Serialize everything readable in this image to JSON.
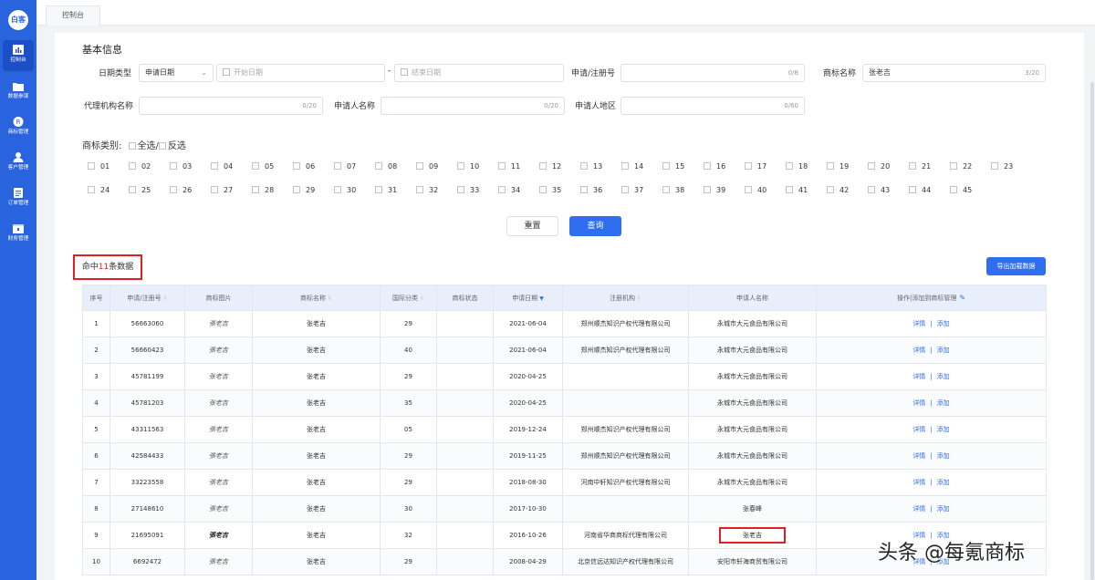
{
  "app": {
    "logo_text": "白客"
  },
  "sidebar": {
    "items": [
      {
        "label": "控制台",
        "icon": "chart-icon",
        "active": true
      },
      {
        "label": "数据参谋",
        "icon": "folder-icon",
        "active": false
      },
      {
        "label": "商标管理",
        "icon": "trademark-icon",
        "active": false
      },
      {
        "label": "客户管理",
        "icon": "user-icon",
        "active": false
      },
      {
        "label": "订单管理",
        "icon": "order-icon",
        "active": false
      },
      {
        "label": "财务管理",
        "icon": "finance-icon",
        "active": false
      }
    ]
  },
  "tabs": [
    {
      "label": "控制台"
    }
  ],
  "filters": {
    "section_title": "基本信息",
    "date_type_label": "日期类型",
    "date_type_value": "申请日期",
    "start_date_placeholder": "开始日期",
    "date_sep": "-",
    "end_date_placeholder": "结束日期",
    "reg_no_label": "申请/注册号",
    "reg_no_count": "0/8",
    "tm_name_label": "商标名称",
    "tm_name_value": "张老吉",
    "tm_name_count": "3/20",
    "agency_label": "代理机构名称",
    "agency_count": "0/20",
    "applicant_label": "申请人名称",
    "applicant_count": "0/20",
    "region_label": "申请人地区",
    "region_count": "0/60"
  },
  "categories": {
    "title": "商标类别:",
    "select_all": "全选/",
    "invert": "反选",
    "items": [
      "01",
      "02",
      "03",
      "04",
      "05",
      "06",
      "07",
      "08",
      "09",
      "10",
      "11",
      "12",
      "13",
      "14",
      "15",
      "16",
      "17",
      "18",
      "19",
      "20",
      "21",
      "22",
      "23",
      "24",
      "25",
      "26",
      "27",
      "28",
      "29",
      "30",
      "31",
      "32",
      "33",
      "34",
      "35",
      "36",
      "37",
      "38",
      "39",
      "40",
      "41",
      "42",
      "43",
      "44",
      "45"
    ]
  },
  "buttons": {
    "reset": "重置",
    "query": "查询",
    "export": "导出加载数据"
  },
  "results": {
    "prefix": "命中",
    "count": "11",
    "suffix": "条数据"
  },
  "table": {
    "headers": [
      "序号",
      "申请/注册号",
      "商标图片",
      "商标名称",
      "国际分类",
      "商标状态",
      "申请日期",
      "注册机构",
      "申请人名称",
      "操作|添加到商标管理"
    ],
    "rows": [
      {
        "no": "1",
        "reg": "56663060",
        "img": "張老吉",
        "name": "张老吉",
        "cls": "29",
        "status": "",
        "date": "2021-06-04",
        "agency": "郑州顺杰知识产权代理有限公司",
        "applicant": "永城市大元食品有限公司"
      },
      {
        "no": "2",
        "reg": "56660423",
        "img": "張老吉",
        "name": "张老吉",
        "cls": "40",
        "status": "",
        "date": "2021-06-04",
        "agency": "郑州顺杰知识产权代理有限公司",
        "applicant": "永城市大元食品有限公司"
      },
      {
        "no": "3",
        "reg": "45781199",
        "img": "张老吉",
        "name": "张老吉",
        "cls": "29",
        "status": "",
        "date": "2020-04-25",
        "agency": "",
        "applicant": "永城市大元食品有限公司"
      },
      {
        "no": "4",
        "reg": "45781203",
        "img": "张老吉",
        "name": "张老吉",
        "cls": "35",
        "status": "",
        "date": "2020-04-25",
        "agency": "",
        "applicant": "永城市大元食品有限公司"
      },
      {
        "no": "5",
        "reg": "43311563",
        "img": "張老吉",
        "name": "张老吉",
        "cls": "05",
        "status": "",
        "date": "2019-12-24",
        "agency": "郑州顺杰知识产权代理有限公司",
        "applicant": "永城市大元食品有限公司"
      },
      {
        "no": "6",
        "reg": "42584433",
        "img": "張老吉",
        "name": "张老吉",
        "cls": "29",
        "status": "",
        "date": "2019-11-25",
        "agency": "郑州顺杰知识产权代理有限公司",
        "applicant": "永城市大元食品有限公司"
      },
      {
        "no": "7",
        "reg": "33223558",
        "img": "張老吉",
        "name": "张老吉",
        "cls": "29",
        "status": "",
        "date": "2018-08-30",
        "agency": "河南中轩知识产权代理有限公司",
        "applicant": "永城市大元食品有限公司"
      },
      {
        "no": "8",
        "reg": "27148610",
        "img": "張老吉",
        "name": "张老吉",
        "cls": "30",
        "status": "",
        "date": "2017-10-30",
        "agency": "",
        "applicant": "张春峰"
      },
      {
        "no": "9",
        "reg": "21695091",
        "img": "張老吉",
        "name": "张老吉",
        "cls": "32",
        "status": "",
        "date": "2016-10-26",
        "agency": "河南省华商商标代理有限公司",
        "applicant": "张老吉"
      },
      {
        "no": "10",
        "reg": "6692472",
        "img": "張老吉",
        "name": "张老吉",
        "cls": "29",
        "status": "",
        "date": "2008-04-29",
        "agency": "北京信远达知识产权代理有限公司",
        "applicant": "安阳市轩海商贸有限公司"
      }
    ],
    "action_detail": "详情",
    "action_sep": "|",
    "action_add": "添加"
  },
  "watermark": "头条 @每氪商标",
  "colors": {
    "primary": "#2f6ef0",
    "sidebar": "#2a63de",
    "highlight": "#e02020"
  }
}
